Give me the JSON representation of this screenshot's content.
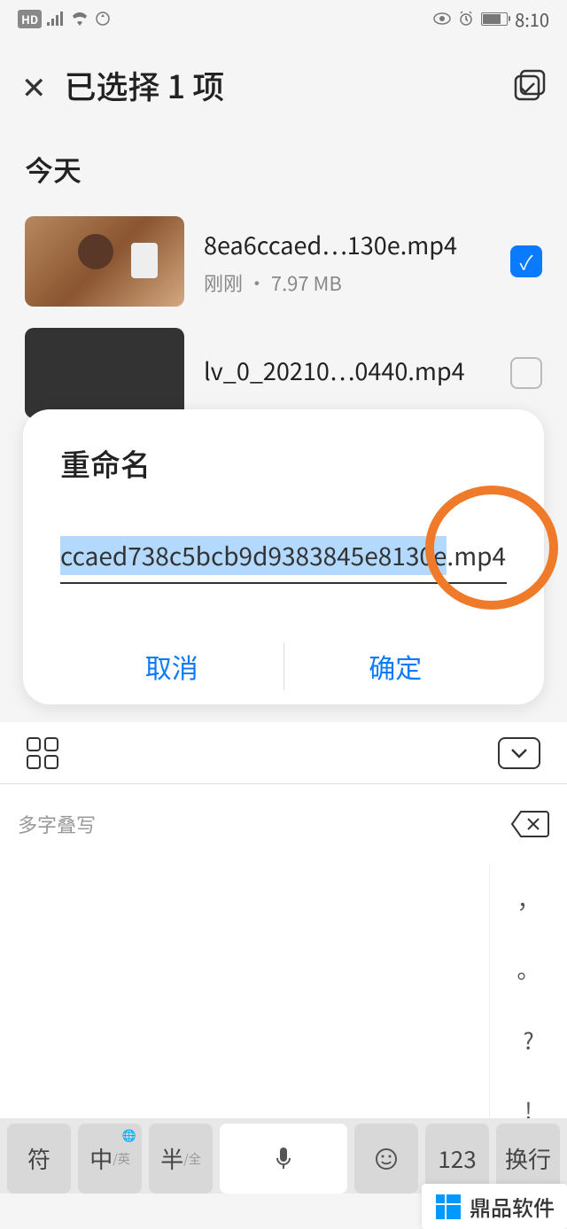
{
  "status": {
    "time": "8:10"
  },
  "header": {
    "title": "已选择 1 项"
  },
  "section": {
    "today": "今天"
  },
  "files": [
    {
      "name": "8ea6ccaed…130e.mp4",
      "meta": "刚刚 · 7.97 MB",
      "checked": true
    },
    {
      "name": "lv_0_20210…0440.mp4",
      "meta": "",
      "checked": false
    }
  ],
  "dialog": {
    "title": "重命名",
    "input_selected": "ccaed738c5bcb9d9383845e8130e",
    "input_rest": ".mp4",
    "cancel": "取消",
    "confirm": "确定"
  },
  "keyboard": {
    "suggest": "多字叠写",
    "side": [
      "，",
      "。",
      "?",
      "!"
    ],
    "bottom": {
      "sym": "符",
      "zh": "中",
      "zh_sub": "/英",
      "half": "半",
      "half_sub": "/全",
      "num": "123",
      "enter": "换行"
    }
  },
  "watermark": "鼎品软件"
}
